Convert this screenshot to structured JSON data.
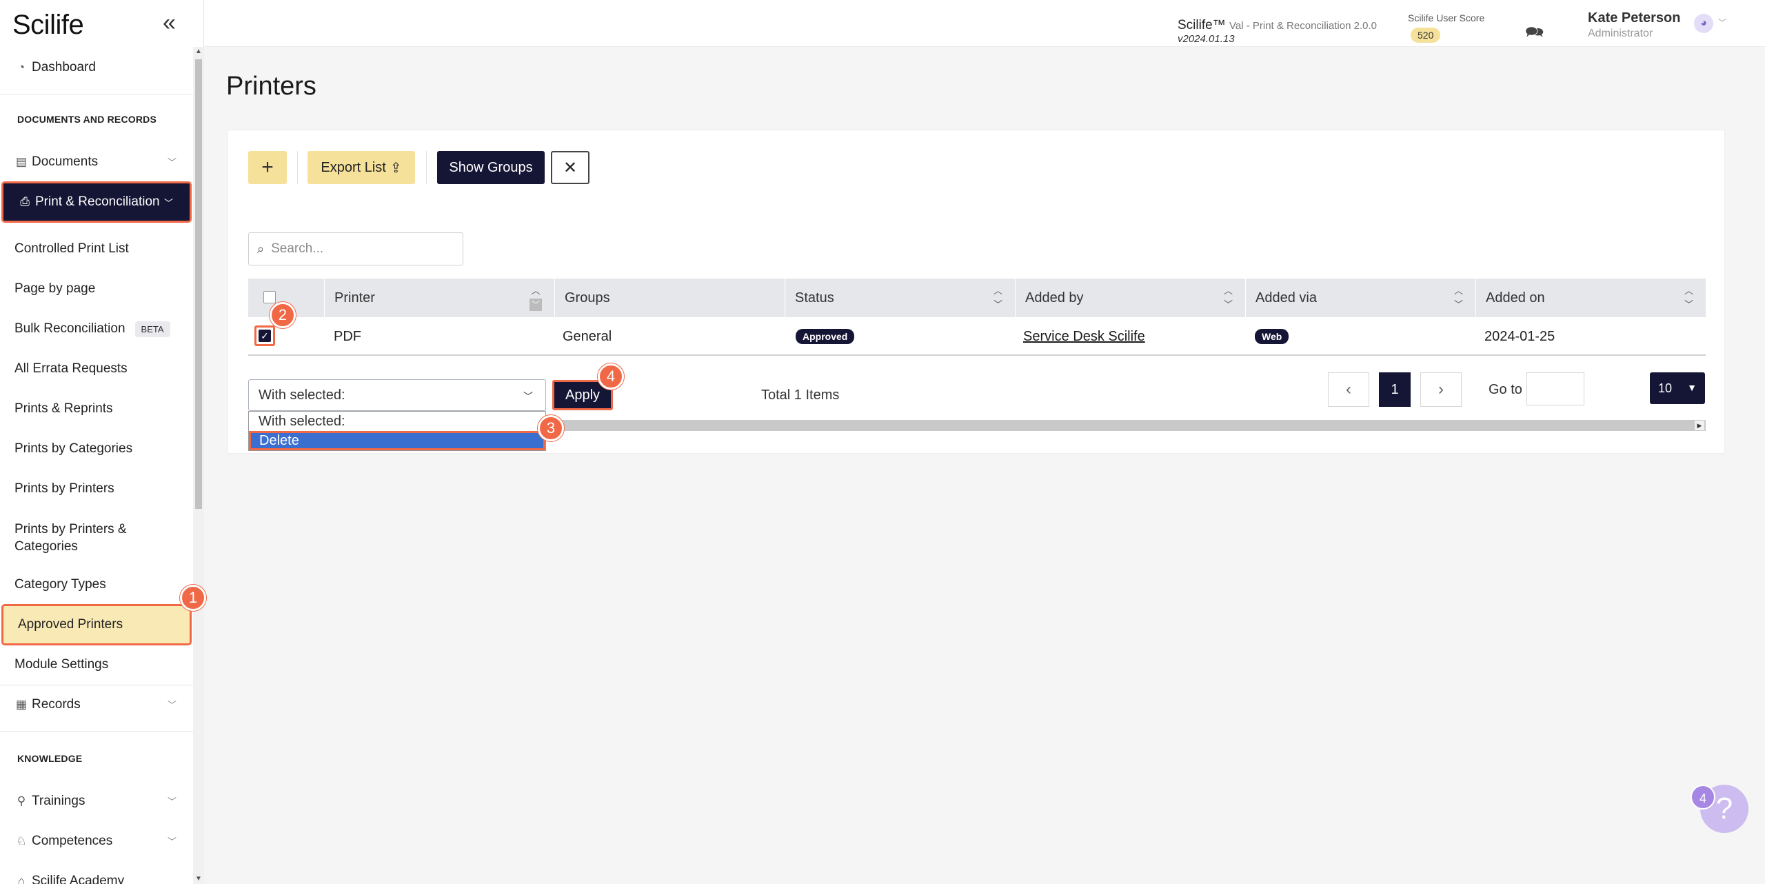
{
  "app": {
    "logo": "Scilife",
    "collapse_icon": "«"
  },
  "header": {
    "app_name": "Scilife™",
    "module": "Val - Print & Reconciliation 2.0.0",
    "version": "v2024.01.13",
    "score_label": "Scilife User Score",
    "score": "520",
    "user_name": "Kate Peterson",
    "user_role": "Administrator"
  },
  "sidebar": {
    "dashboard": "Dashboard",
    "section_docs": "DOCUMENTS AND RECORDS",
    "documents": "Documents",
    "print_recon": "Print & Reconciliation",
    "items": [
      "Controlled Print List",
      "Page by page",
      "Bulk Reconciliation",
      "All Errata Requests",
      "Prints & Reprints",
      "Prints by Categories",
      "Prints by Printers",
      "Prints by Printers & Categories",
      "Category Types",
      "Approved Printers",
      "Module Settings"
    ],
    "beta": "BETA",
    "records": "Records",
    "section_knowledge": "KNOWLEDGE",
    "trainings": "Trainings",
    "competences": "Competences",
    "academy": "Scilife Academy"
  },
  "page": {
    "title": "Printers"
  },
  "toolbar": {
    "add": "+",
    "export": "Export List",
    "export_icon": "⇪",
    "groups": "Show Groups",
    "close": "✕"
  },
  "search": {
    "placeholder": "Search..."
  },
  "table": {
    "columns": [
      "Printer",
      "Groups",
      "Status",
      "Added by",
      "Added via",
      "Added on"
    ],
    "rows": [
      {
        "printer": "PDF",
        "groups": "General",
        "status": "Approved",
        "added_by": "Service Desk Scilife",
        "added_via": "Web",
        "added_on": "2024-01-25"
      }
    ]
  },
  "bulk": {
    "select_value": "With selected:",
    "options": [
      "With selected:",
      "Delete"
    ],
    "apply": "Apply"
  },
  "pagination": {
    "total": "Total 1 Items",
    "current": "1",
    "goto_label": "Go to",
    "page_size": "10"
  },
  "steps": [
    "1",
    "2",
    "3",
    "4"
  ],
  "help": {
    "badge": "4",
    "icon": "?"
  },
  "colors": {
    "navy": "#151535",
    "highlight": "#f06845",
    "yellow": "#f6e19a"
  }
}
